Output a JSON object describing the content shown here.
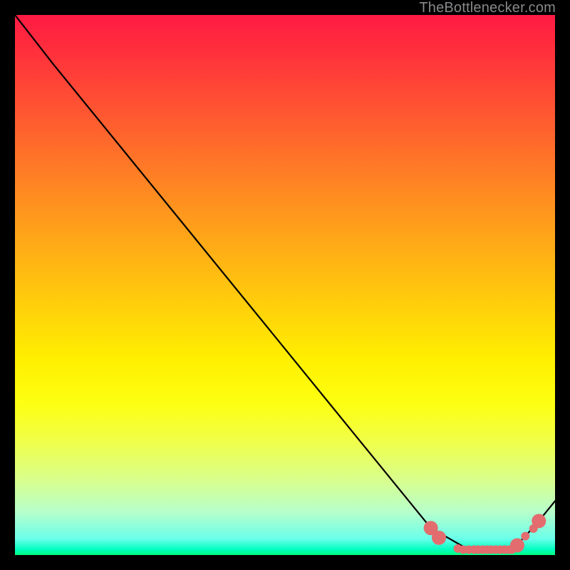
{
  "watermark": "TheBottlenecker.com",
  "chart_data": {
    "type": "line",
    "title": "",
    "xlabel": "",
    "ylabel": "",
    "xlim": [
      0,
      100
    ],
    "ylim": [
      0,
      100
    ],
    "background": "heat-gradient-red-green",
    "x": [
      0,
      7,
      77,
      84,
      92,
      94.5,
      97,
      100
    ],
    "values": [
      100,
      91,
      5,
      1,
      1,
      3.5,
      6.3,
      10
    ],
    "highlight_points": {
      "color": "#e36c6e",
      "radius_px": [
        10,
        10,
        6,
        6,
        6,
        6,
        6,
        6,
        6,
        6,
        6,
        6,
        6,
        6,
        6,
        10,
        6,
        6,
        10
      ],
      "x": [
        77,
        78.5,
        82,
        83,
        84,
        85,
        85.8,
        86.6,
        87.4,
        88.2,
        89,
        89.8,
        90.6,
        91.4,
        92,
        93,
        94.5,
        96,
        97
      ],
      "y": [
        5,
        3.2,
        1.2,
        1,
        1,
        1,
        1,
        1,
        1,
        1,
        1,
        1,
        1,
        1,
        1,
        1.8,
        3.5,
        4.9,
        6.3
      ]
    }
  }
}
